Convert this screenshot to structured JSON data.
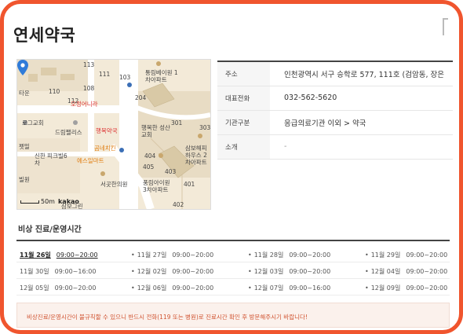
{
  "pharmacy": {
    "name": "연세약국"
  },
  "map": {
    "labels": {
      "l1": "113",
      "l2": "111",
      "l3": "110",
      "l4": "112",
      "l5": "타운",
      "l6": "오정어니라",
      "l7": "로그교회",
      "l8": "드림팰리스",
      "l9": "신한 피크빌6차",
      "l10": "펫밀",
      "l11": "빌원",
      "l12": "통림베이원 1차아파트",
      "l13": "행복한 성산교회",
      "l14": "행복약국",
      "l15": "곰네치킨",
      "l16": "에스일마트",
      "l17": "서곳한의원",
      "l18": "삼보해피하우스 2차아파트",
      "l19": "풍림아이원 3차아파트",
      "l20": "301",
      "l21": "303",
      "l22": "405",
      "l23": "403",
      "l24": "401",
      "l25": "402",
      "l26": "404",
      "l27": "204",
      "l28": "103",
      "l29": "108",
      "l30": "삼보그린"
    },
    "scale": "50m",
    "brand": "kakao"
  },
  "info": {
    "rows": [
      {
        "label": "주소",
        "value": "인천광역시 서구 승학로 577, 111호 (검암동, 장은"
      },
      {
        "label": "대표전화",
        "value": "032-562-5620"
      },
      {
        "label": "기관구분",
        "value": "응급의료기관 이외 > 약국"
      },
      {
        "label": "소개",
        "value": "-"
      }
    ]
  },
  "hours": {
    "title": "비상 진료/운영시간",
    "rows": [
      [
        {
          "date": "11월 26일",
          "time": "09:00~20:00"
        },
        {
          "date": "11월 27일",
          "time": "09:00~20:00"
        },
        {
          "date": "11월 28일",
          "time": "09:00~20:00"
        },
        {
          "date": "11월 29일",
          "time": "09:00~20:00"
        }
      ],
      [
        {
          "date": "11월 30일",
          "time": "09:00~16:00"
        },
        {
          "date": "12월 02일",
          "time": "09:00~20:00"
        },
        {
          "date": "12월 03일",
          "time": "09:00~20:00"
        },
        {
          "date": "12월 04일",
          "time": "09:00~20:00"
        }
      ],
      [
        {
          "date": "12월 05일",
          "time": "09:00~20:00"
        },
        {
          "date": "12월 06일",
          "time": "09:00~20:00"
        },
        {
          "date": "12월 07일",
          "time": "09:00~16:00"
        },
        {
          "date": "12월 09일",
          "time": "09:00~20:00"
        }
      ]
    ],
    "bullet": "•"
  },
  "notice": "비상진료/운영시간이 불규칙할 수 있으니 반드시 전화(119 또는 병원)로 진료시간 확인 후 방문해주시기 바랍니다!",
  "colors": {
    "frame": "#f0552e",
    "pin": "#2f7bd9",
    "notice_text": "#d0522f"
  }
}
